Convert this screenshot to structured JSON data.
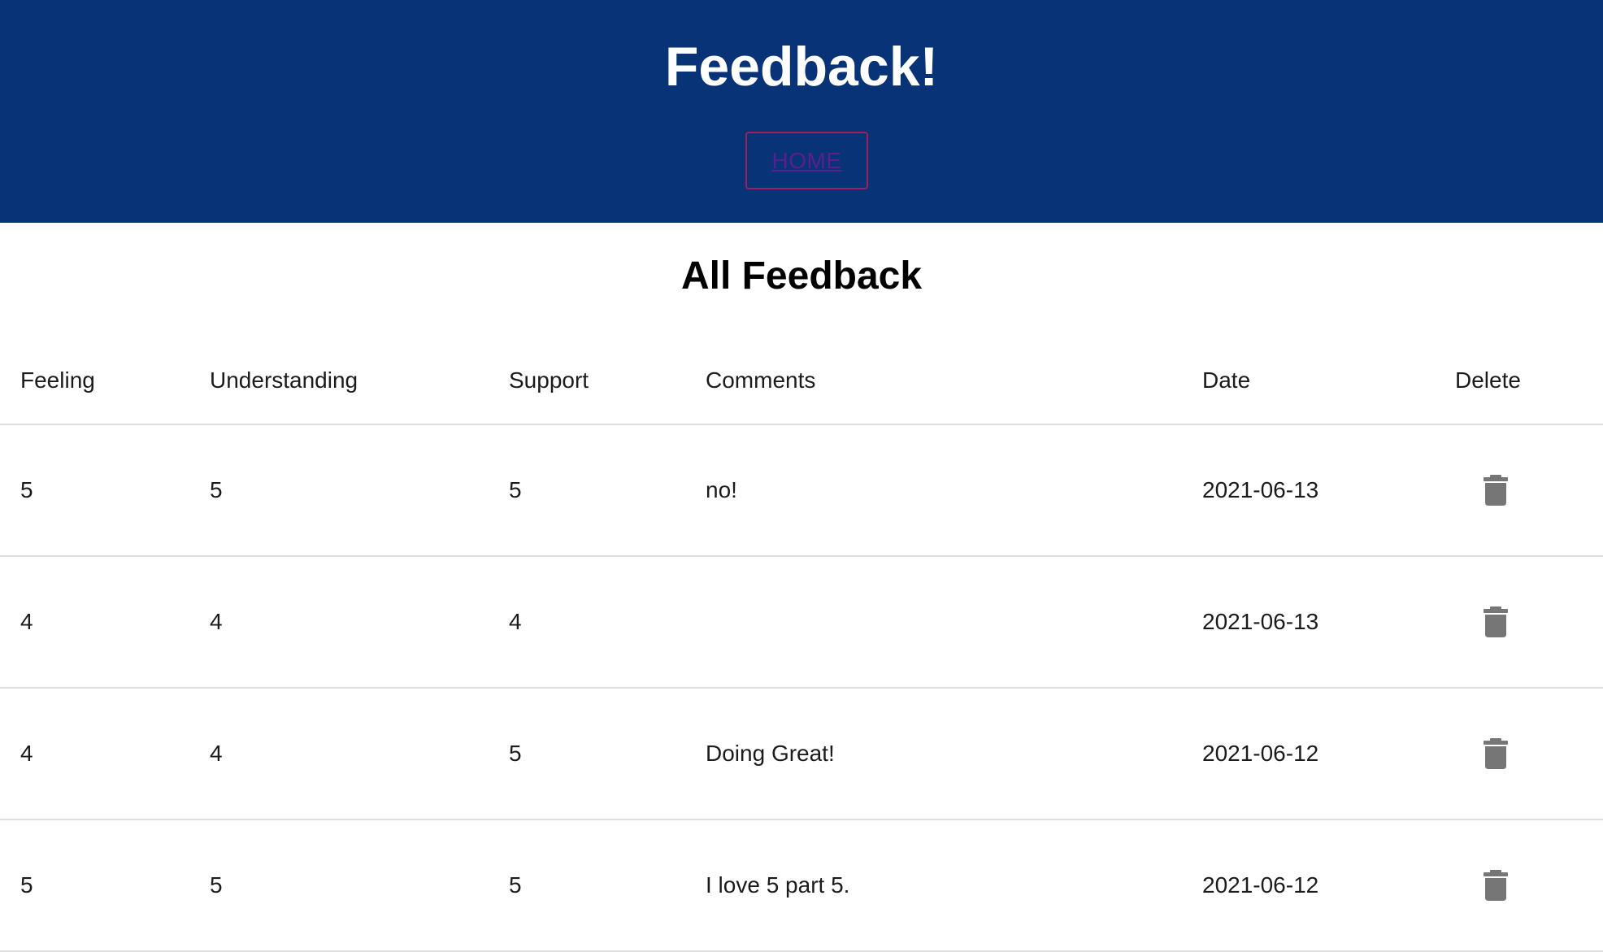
{
  "header": {
    "title": "Feedback!",
    "home_label": "HOME",
    "background_color": "#083376"
  },
  "main": {
    "title": "All Feedback",
    "table": {
      "columns": [
        "Feeling",
        "Understanding",
        "Support",
        "Comments",
        "Date",
        "Delete"
      ],
      "rows": [
        {
          "feeling": "5",
          "understanding": "5",
          "support": "5",
          "comments": "no!",
          "date": "2021-06-13",
          "delete_icon": "trash-icon"
        },
        {
          "feeling": "4",
          "understanding": "4",
          "support": "4",
          "comments": "",
          "date": "2021-06-13",
          "delete_icon": "trash-icon"
        },
        {
          "feeling": "4",
          "understanding": "4",
          "support": "5",
          "comments": "Doing Great!",
          "date": "2021-06-12",
          "delete_icon": "trash-icon"
        },
        {
          "feeling": "5",
          "understanding": "5",
          "support": "5",
          "comments": "I love 5 part 5.",
          "date": "2021-06-12",
          "delete_icon": "trash-icon"
        }
      ]
    }
  }
}
